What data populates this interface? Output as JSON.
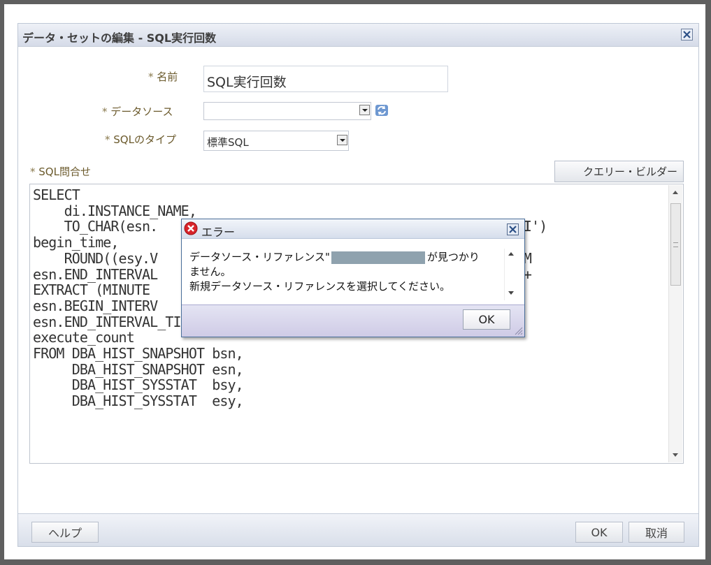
{
  "dialog": {
    "title": "データ・セットの編集 - SQL実行回数"
  },
  "form": {
    "name_label": "名前",
    "name_value": "SQL実行回数",
    "datasource_label": "データソース",
    "datasource_value": "",
    "sqltype_label": "SQLのタイプ",
    "sqltype_value": "標準SQL",
    "required_mark": "*",
    "query_label": "SQL問合せ",
    "query_builder_button": "クエリー・ビルダー",
    "sql_lines": [
      "SELECT",
      "    di.INSTANCE_NAME,",
      "    TO_CHAR(esn.                                              MI')",
      "begin_time,",
      "    ROUND((esy.V                                             ROM",
      "esn.END_INTERVAL                                            00 +",
      "EXTRACT (MINUTE",
      "esn.BEGIN_INTERV",
      "esn.END_INTERVAL_TIME-esn.BEGIN_INTERVAL_TIME)), 1)",
      "execute_count",
      "FROM DBA_HIST_SNAPSHOT bsn,",
      "     DBA_HIST_SNAPSHOT esn,",
      "     DBA_HIST_SYSSTAT  bsy,",
      "     DBA_HIST_SYSSTAT  esy,"
    ]
  },
  "footer": {
    "help_button": "ヘルプ",
    "ok_button": "OK",
    "cancel_button": "取消"
  },
  "error_popup": {
    "title": "エラー",
    "message_part1": "データソース・リファレンス\"",
    "message_part2": "が見つかり",
    "message_line2": "ません。",
    "message_line3": "新規データソース・リファレンスを選択してください。",
    "ok_button": "OK"
  },
  "icons": {
    "close": "close-icon",
    "refresh": "refresh-icon",
    "error": "error-icon"
  },
  "colors": {
    "label": "#6b5a2c",
    "titlebar": "#d5dbe8",
    "error_red": "#d8242a"
  }
}
